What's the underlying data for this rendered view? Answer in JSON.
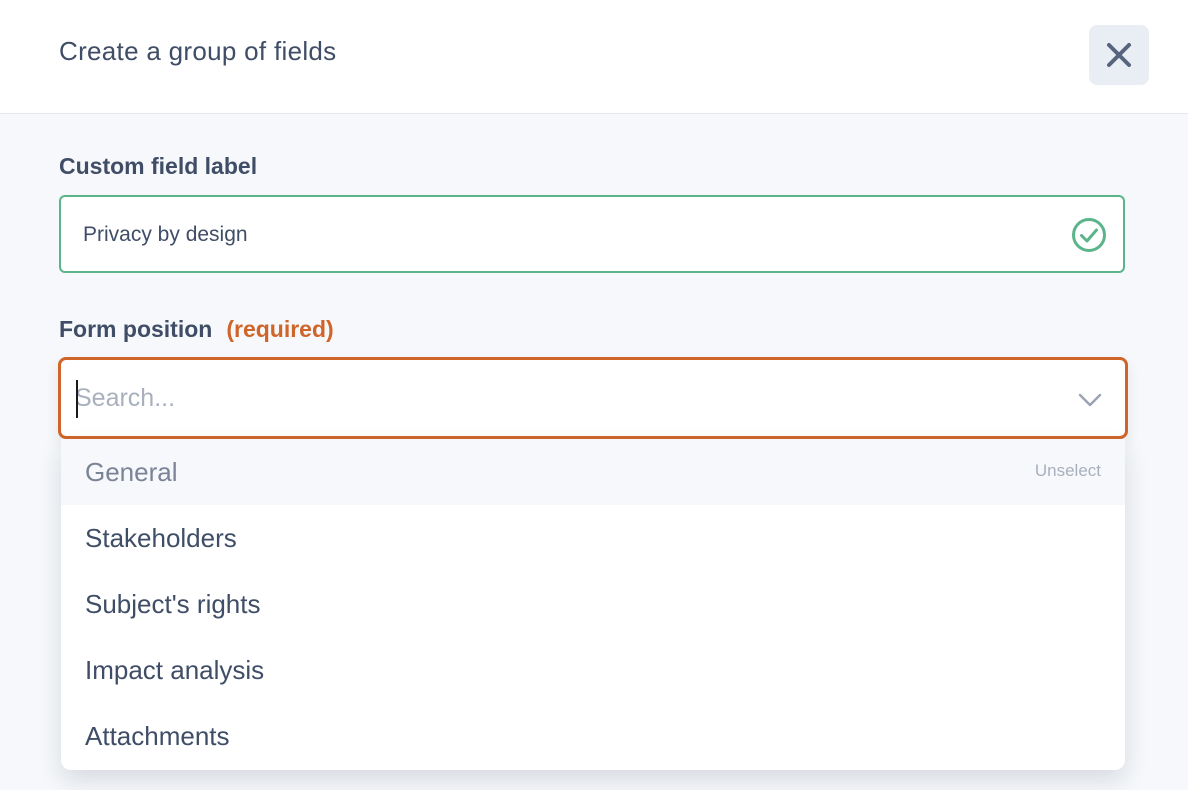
{
  "dialog": {
    "title": "Create a group of fields",
    "close_icon": "close-icon"
  },
  "custom_field": {
    "label": "Custom field label",
    "value": "Privacy by design",
    "valid_icon": "check-circle-icon",
    "valid_color": "#5bb48a"
  },
  "form_position": {
    "label": "Form position",
    "required_text": "(required)",
    "required_color": "#d0652a",
    "search_placeholder": "Search...",
    "chevron_icon": "chevron-down-icon",
    "options": [
      {
        "label": "General",
        "selected": true,
        "action": "Unselect"
      },
      {
        "label": "Stakeholders"
      },
      {
        "label": "Subject's rights"
      },
      {
        "label": "Impact analysis"
      },
      {
        "label": "Attachments"
      }
    ]
  }
}
